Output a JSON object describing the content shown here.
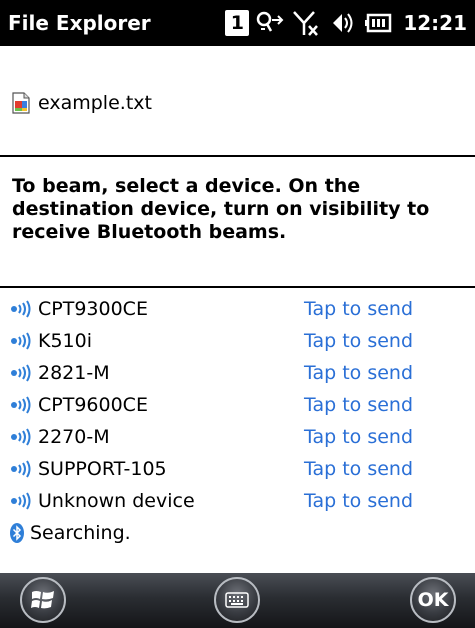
{
  "titlebar": {
    "title": "File Explorer",
    "badge": "1",
    "clock": "12:21",
    "icons": [
      "notification-badge-icon",
      "data-connection-icon",
      "no-signal-icon",
      "volume-icon",
      "battery-icon"
    ]
  },
  "file": {
    "name": "example.txt",
    "icon": "text-file-icon"
  },
  "instruction": "To beam, select a device. On the destination device, turn on visibility to receive Bluetooth beams.",
  "devices": [
    {
      "name": "CPT9300CE",
      "action": "Tap to send"
    },
    {
      "name": "K510i",
      "action": "Tap to send"
    },
    {
      "name": "2821-M",
      "action": "Tap to send"
    },
    {
      "name": "CPT9600CE",
      "action": "Tap to send"
    },
    {
      "name": "2270-M",
      "action": "Tap to send"
    },
    {
      "name": "SUPPORT-105",
      "action": "Tap to send"
    },
    {
      "name": "Unknown device",
      "action": "Tap to send"
    }
  ],
  "search_status": "Searching.",
  "bottombar": {
    "ok_label": "OK",
    "icons": [
      "windows-start-icon",
      "keyboard-icon",
      "ok-icon"
    ]
  },
  "colors": {
    "titlebar_bg": "#000000",
    "link": "#2a6fd6",
    "signal": "#2f7fd8"
  }
}
